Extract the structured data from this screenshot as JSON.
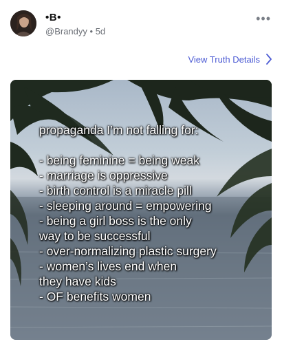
{
  "post": {
    "display_name": "•B•",
    "handle": "@Brandyy",
    "age": "5d",
    "more_icon": "more-horizontal-icon",
    "view_details_label": "View Truth Details",
    "chevron_icon": "chevron-right-icon",
    "accent_color": "#4c5bd4"
  },
  "media": {
    "headline": "propaganda I’m not falling for:",
    "lines": [
      "- being feminine = being weak",
      "- marriage is oppressive",
      "- birth control is a miracle pill",
      "- sleeping around = empowering",
      "- being a girl boss is the only",
      "way to be successful",
      "- over-normalizing plastic surgery",
      "- women’s lives end when",
      "they have kids",
      "- OF benefits women"
    ]
  }
}
